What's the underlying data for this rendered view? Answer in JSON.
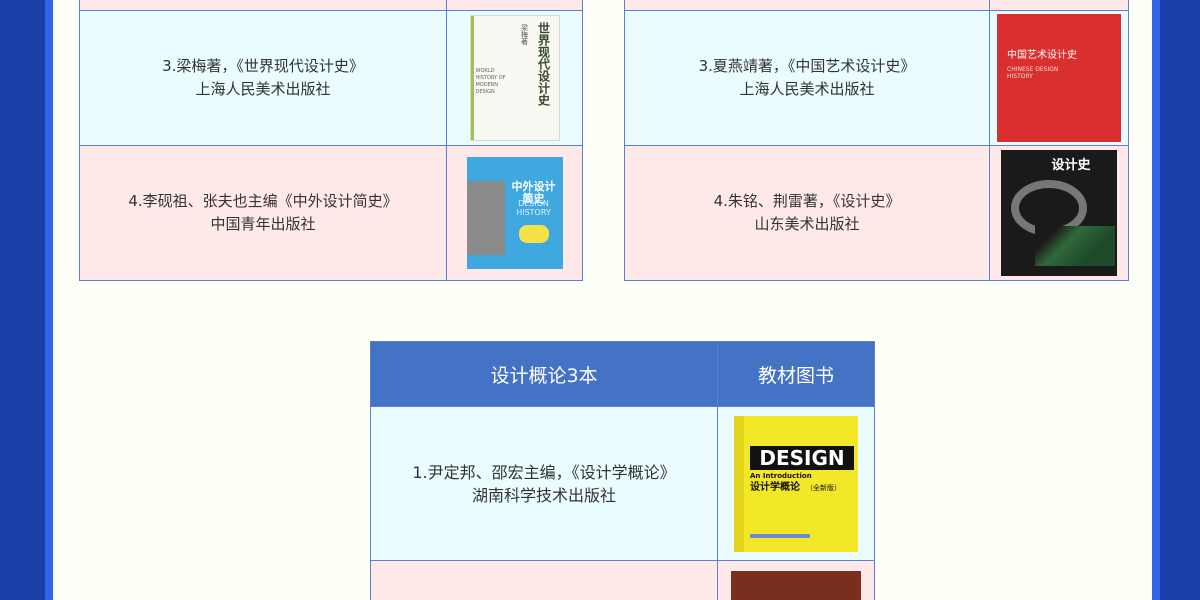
{
  "left_table": {
    "rows": [
      {
        "text": "3.梁梅著，《世界现代设计史》",
        "publisher": "上海人民美术出版社",
        "cover": {
          "title": "世界现代设计史",
          "author": "梁梅著",
          "subtitle": "WORLD HISTORY OF MODERN DESIGN",
          "bg": "#f6f8f1"
        }
      },
      {
        "text": "4.李砚祖、张夫也主编《中外设计简史》",
        "publisher": "中国青年出版社",
        "cover": {
          "title": "中外设计简史",
          "subtitle": "DESIGN HISTORY",
          "bg": "#3fa9df"
        }
      }
    ]
  },
  "right_table": {
    "rows": [
      {
        "text": "3.夏燕靖著，《中国艺术设计史》",
        "publisher": "上海人民美术出版社",
        "cover": {
          "title": "中国艺术设计史",
          "subtitle": "CHINESE DESIGN HISTORY",
          "bg": "#d92f2f"
        }
      },
      {
        "text": "4.朱铭、荆雷著，《设计史》",
        "publisher": "山东美术出版社",
        "cover": {
          "title": "设计史",
          "bg": "#1a1a1a"
        }
      }
    ]
  },
  "bottom_table": {
    "header": {
      "col1": "设计概论3本",
      "col2": "教材图书"
    },
    "rows": [
      {
        "text": "1.尹定邦、邵宏主编，《设计学概论》",
        "publisher": "湖南科学技术出版社",
        "cover": {
          "title": "设计学概论",
          "edition": "（全新版）",
          "logo": "DESIGN",
          "subtitle": "An Introduction",
          "bg": "#f3e828"
        }
      },
      {
        "cover": {
          "bg": "#7a2e1e"
        }
      }
    ]
  },
  "colors": {
    "accent": "#4472c4",
    "frame": "#2f66e8",
    "background": "#1a3fa8"
  }
}
